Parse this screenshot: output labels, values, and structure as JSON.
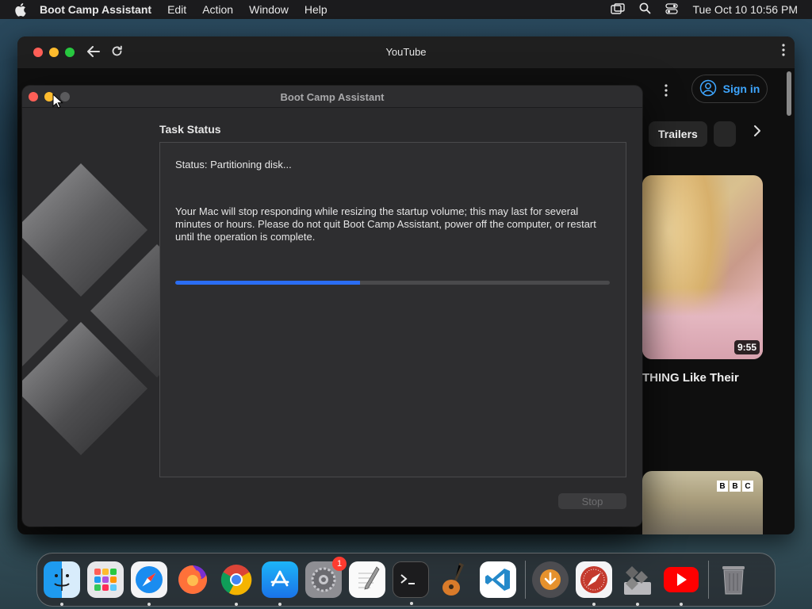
{
  "menubar": {
    "app_name": "Boot Camp Assistant",
    "items": [
      "Edit",
      "Action",
      "Window",
      "Help"
    ],
    "clock": "Tue Oct 10  10:56 PM"
  },
  "browser": {
    "title": "YouTube",
    "sign_in_label": "Sign in",
    "chip_label": "Trailers",
    "video_duration": "9:55",
    "video_title": "THING Like Their",
    "bbc": [
      "B",
      "B",
      "C"
    ]
  },
  "bootcamp": {
    "window_title": "Boot Camp Assistant",
    "heading": "Task Status",
    "status_text": "Status: Partitioning disk...",
    "warning_text": "Your Mac will stop responding while resizing the startup volume; this may last for several minutes or hours. Please do not quit Boot Camp Assistant, power off the computer, or restart until the operation is complete.",
    "progress": 0.425,
    "stop_label": "Stop"
  },
  "dock": {
    "apps": [
      "Finder",
      "Launchpad",
      "Safari",
      "Firefox",
      "Chrome",
      "App Store",
      "System Settings",
      "TextEdit",
      "Terminal",
      "GarageBand",
      "Visual Studio Code",
      "Downloads",
      "Safari Technology Preview",
      "Boot Camp Assistant",
      "YouTube",
      "Trash"
    ],
    "settings_badge": "1"
  },
  "colors": {
    "progress_fill": "#2a6df3",
    "close": "#fe5f57",
    "minimize": "#febc2e",
    "zoom": "#28c840"
  }
}
